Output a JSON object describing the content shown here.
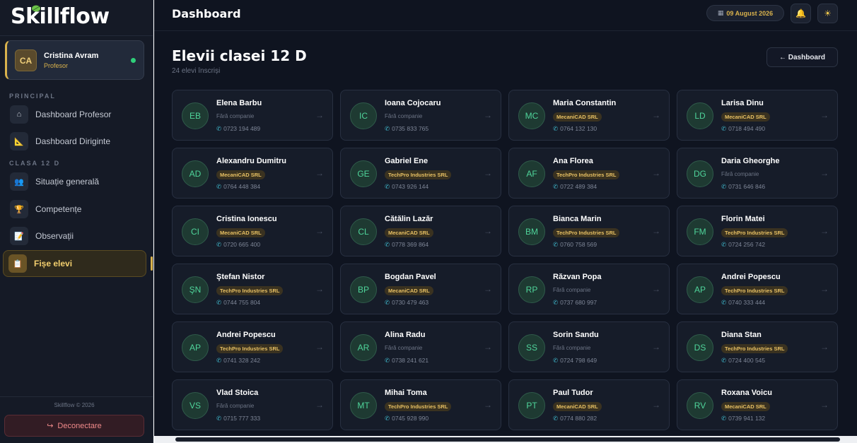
{
  "app": {
    "name": "Skillflow"
  },
  "user": {
    "initials": "CA",
    "name": "Cristina Avram",
    "role": "Profesor"
  },
  "sidebar": {
    "sections": [
      {
        "label": "PRINCIPAL"
      },
      {
        "label": "CLASA 12 D"
      }
    ],
    "items": [
      {
        "label": "Dashboard Profesor",
        "icon": "home-icon",
        "glyph": "⌂"
      },
      {
        "label": "Dashboard Diriginte",
        "icon": "ruler-triangle-icon",
        "glyph": "📐"
      },
      {
        "label": "Situație generală",
        "icon": "group-icon",
        "glyph": "👥"
      },
      {
        "label": "Competențe",
        "icon": "trophy-icon",
        "glyph": "🏆"
      },
      {
        "label": "Observații",
        "icon": "notepad-icon",
        "glyph": "📝"
      },
      {
        "label": "Fișe elevi",
        "icon": "clipboard-icon",
        "glyph": "📋",
        "active": true
      }
    ],
    "copyright": "Skillflow © 2026",
    "logout_label": "Deconectare"
  },
  "topbar": {
    "title": "Dashboard",
    "date": "09 August 2026"
  },
  "page": {
    "title": "Elevii clasei 12 D",
    "subtitle": "24 elevi înscriși",
    "back_label": "← Dashboard"
  },
  "students": [
    {
      "initials": "EB",
      "name": "Elena Barbu",
      "company": "Fără companie",
      "has_company": false,
      "phone": "0723 194 489"
    },
    {
      "initials": "IC",
      "name": "Ioana Cojocaru",
      "company": "Fără companie",
      "has_company": false,
      "phone": "0735 833 765"
    },
    {
      "initials": "MC",
      "name": "Maria Constantin",
      "company": "MecaniCAD SRL",
      "has_company": true,
      "phone": "0764 132 130"
    },
    {
      "initials": "LD",
      "name": "Larisa Dinu",
      "company": "MecaniCAD SRL",
      "has_company": true,
      "phone": "0718 494 490"
    },
    {
      "initials": "AD",
      "name": "Alexandru Dumitru",
      "company": "MecaniCAD SRL",
      "has_company": true,
      "phone": "0764 448 384"
    },
    {
      "initials": "GE",
      "name": "Gabriel Ene",
      "company": "TechPro Industries SRL",
      "has_company": true,
      "phone": "0743 926 144"
    },
    {
      "initials": "AF",
      "name": "Ana Florea",
      "company": "TechPro Industries SRL",
      "has_company": true,
      "phone": "0722 489 384"
    },
    {
      "initials": "DG",
      "name": "Daria Gheorghe",
      "company": "Fără companie",
      "has_company": false,
      "phone": "0731 646 846"
    },
    {
      "initials": "CI",
      "name": "Cristina Ionescu",
      "company": "MecaniCAD SRL",
      "has_company": true,
      "phone": "0720 665 400"
    },
    {
      "initials": "CL",
      "name": "Cătălin Lazăr",
      "company": "MecaniCAD SRL",
      "has_company": true,
      "phone": "0778 369 864"
    },
    {
      "initials": "BM",
      "name": "Bianca Marin",
      "company": "TechPro Industries SRL",
      "has_company": true,
      "phone": "0760 758 569"
    },
    {
      "initials": "FM",
      "name": "Florin Matei",
      "company": "TechPro Industries SRL",
      "has_company": true,
      "phone": "0724 256 742"
    },
    {
      "initials": "ŞN",
      "name": "Ştefan Nistor",
      "company": "TechPro Industries SRL",
      "has_company": true,
      "phone": "0744 755 804"
    },
    {
      "initials": "BP",
      "name": "Bogdan Pavel",
      "company": "MecaniCAD SRL",
      "has_company": true,
      "phone": "0730 479 463"
    },
    {
      "initials": "RP",
      "name": "Răzvan Popa",
      "company": "Fără companie",
      "has_company": false,
      "phone": "0737 680 997"
    },
    {
      "initials": "AP",
      "name": "Andrei Popescu",
      "company": "TechPro Industries SRL",
      "has_company": true,
      "phone": "0740 333 444"
    },
    {
      "initials": "AP",
      "name": "Andrei Popescu",
      "company": "TechPro Industries SRL",
      "has_company": true,
      "phone": "0741 328 242"
    },
    {
      "initials": "AR",
      "name": "Alina Radu",
      "company": "Fără companie",
      "has_company": false,
      "phone": "0738 241 621"
    },
    {
      "initials": "SS",
      "name": "Sorin Sandu",
      "company": "Fără companie",
      "has_company": false,
      "phone": "0724 798 649"
    },
    {
      "initials": "DS",
      "name": "Diana Stan",
      "company": "TechPro Industries SRL",
      "has_company": true,
      "phone": "0724 400 545"
    },
    {
      "initials": "VS",
      "name": "Vlad Stoica",
      "company": "Fără companie",
      "has_company": false,
      "phone": "0715 777 333"
    },
    {
      "initials": "MT",
      "name": "Mihai Toma",
      "company": "TechPro Industries SRL",
      "has_company": true,
      "phone": "0745 928 990"
    },
    {
      "initials": "PT",
      "name": "Paul Tudor",
      "company": "MecaniCAD SRL",
      "has_company": true,
      "phone": "0774 880 282"
    },
    {
      "initials": "RV",
      "name": "Roxana Voicu",
      "company": "MecaniCAD SRL",
      "has_company": true,
      "phone": "0739 941 132"
    }
  ],
  "colors": {
    "accent": "#d9b24c",
    "avatar_green": "#4fd49a",
    "logout_red": "#f08a8a",
    "online": "#2fcf7a"
  }
}
